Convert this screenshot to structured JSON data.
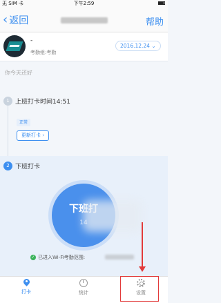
{
  "status_bar": {
    "carrier": "无 SIM 卡",
    "time": "下午2:59"
  },
  "nav": {
    "back_label": "返回",
    "help_label": "帮助"
  },
  "group": {
    "name": "-",
    "subtitle": "考勤组:考勤",
    "date": "2016.12.24"
  },
  "greeting": "你今天还好",
  "timeline": {
    "step1_num": "1",
    "step1_label": "上班打卡时间14:51",
    "step1_badge": "正常",
    "step1_update": "更新打卡",
    "step2_num": "2",
    "step2_label": "下班打卡"
  },
  "punch": {
    "label": "下班打",
    "time": "14"
  },
  "wifi": {
    "text": "已进入Wi-Fi考勤范围:"
  },
  "tabs": [
    {
      "label": "打卡",
      "icon": "location-pin-icon",
      "active": true
    },
    {
      "label": "统计",
      "icon": "clock-icon",
      "active": false
    },
    {
      "label": "设置",
      "icon": "gear-icon",
      "active": false
    }
  ],
  "colors": {
    "accent": "#3d8ff0",
    "annotation": "#e23a3a",
    "success": "#3bb35b"
  }
}
